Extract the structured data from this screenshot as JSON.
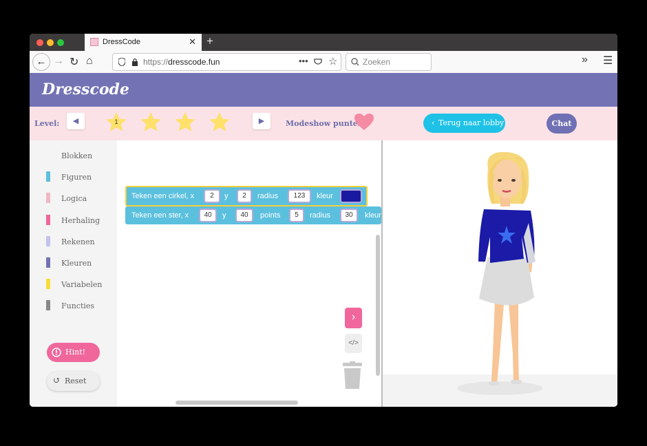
{
  "browser": {
    "tab_title": "DressCode",
    "new_tab": "+",
    "url_scheme": "https://",
    "url_domain": "dresscode.fun",
    "search_placeholder": "Zoeken"
  },
  "app": {
    "logo": "Dresscode",
    "level_label": "Level:",
    "current_level": "1",
    "stars_total": 4,
    "punten_label": "Modeshow punten:",
    "lobby_button": "Terug naar lobby",
    "chat_button": "Chat"
  },
  "sidebar": {
    "header": "Blokken",
    "categories": [
      {
        "label": "Figuren",
        "color": "#5bc0de"
      },
      {
        "label": "Logica",
        "color": "#f2b7c4"
      },
      {
        "label": "Herhaling",
        "color": "#f0679b"
      },
      {
        "label": "Rekenen",
        "color": "#c2c2ee"
      },
      {
        "label": "Kleuren",
        "color": "#7272b4"
      },
      {
        "label": "Variabelen",
        "color": "#f7dc3a"
      },
      {
        "label": "Functies",
        "color": "#888888"
      }
    ],
    "hint_button": "Hint!",
    "reset_button": "Reset"
  },
  "blocks": {
    "circle": {
      "label": "Teken een cirkel, x",
      "x": "2",
      "y_label": "y",
      "y": "2",
      "radius_label": "radius",
      "radius": "123",
      "color_label": "kleur",
      "color": "#1a1aa0"
    },
    "star": {
      "label": "Teken een ster, x",
      "x": "40",
      "y_label": "y",
      "y": "40",
      "points_label": "points",
      "points": "5",
      "radius_label": "radius",
      "radius": "30",
      "color_label": "kleur"
    }
  },
  "colors": {
    "header": "#7272b4",
    "levelbar": "#fbe2e6",
    "star": "#fde16a",
    "lobby": "#1fc2e6",
    "hint": "#f0679b",
    "shirt": "#1b1ba8",
    "skirt": "#dcdcdc"
  }
}
